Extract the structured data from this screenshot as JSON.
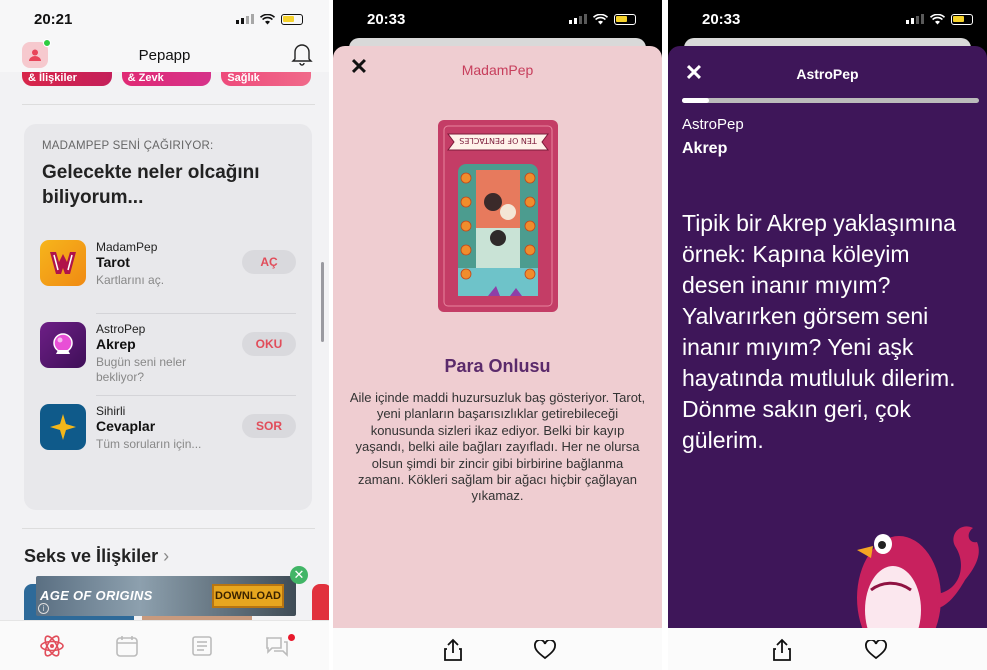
{
  "screen1": {
    "status": {
      "time": "20:21"
    },
    "header": {
      "title": "Pepapp"
    },
    "chips": [
      "& İlişkiler",
      "& Zevk",
      "Sağlık"
    ],
    "card": {
      "kicker": "MADAMPEP SENİ ÇAĞIRIYOR:",
      "headline": "Gelecekte neler olcağını biliyorum...",
      "rows": [
        {
          "brand": "MadamPep",
          "name": "Tarot",
          "sub": "Kartlarını aç.",
          "action": "AÇ",
          "icon": "madampep-logo-icon"
        },
        {
          "brand": "AstroPep",
          "name": "Akrep",
          "sub": "Bugün seni neler bekliyor?",
          "action": "OKU",
          "icon": "crystal-ball-icon"
        },
        {
          "brand": "Sihirli",
          "name": "Cevaplar",
          "sub": "Tüm soruların için...",
          "action": "SOR",
          "icon": "star-icon"
        }
      ]
    },
    "section": {
      "title": "Seks ve İlişkiler",
      "chevron": "›"
    },
    "ad": {
      "title": "AGE OF ORIGINS",
      "button": "DOWNLOAD",
      "info": "i",
      "close": "✕"
    },
    "tabs": [
      "atom-icon",
      "calendar-icon",
      "news-icon",
      "chat-icon"
    ],
    "colors": {
      "accent": "#e14d5a",
      "chip1": "#d8264a",
      "chip2": "#e02a74",
      "chip3": "#ee4a7b"
    }
  },
  "screen2": {
    "status": {
      "time": "20:33"
    },
    "header": {
      "title": "MadamPep",
      "close": "✕"
    },
    "card_banner": "TEN OF PENTACLES",
    "card_title": "Para Onlusu",
    "card_text": "Aile içinde maddi huzursuzluk baş gösteriyor. Tarot, yeni planların başarısızlıklar getirebileceği konusunda sizleri ikaz ediyor. Belki bir kayıp yaşandı, belki aile bağları zayıfladı. Her ne olursa olsun şimdi bir zincir gibi birbirine bağlanma zamanı. Kökleri sağlam bir ağacı hiçbir çağlayan yıkamaz.",
    "colors": {
      "background": "#efcdd1",
      "title": "#5b2a6b"
    }
  },
  "screen3": {
    "status": {
      "time": "20:33"
    },
    "header": {
      "title": "AstroPep",
      "close": "✕"
    },
    "progress": 0.09,
    "brand": "AstroPep",
    "sign": "Akrep",
    "text": "Tipik bir Akrep yaklaşımına örnek: Kapına köleyim desen inanır mıyım? Yalvarırken görsem seni inanır mıyım? Yeni aşk hayatında mutluluk dilerim. Dönme sakın geri, çok gülerim.",
    "colors": {
      "background": "#3e1659"
    }
  },
  "bottom_actions": [
    "share-icon",
    "heart-icon"
  ]
}
